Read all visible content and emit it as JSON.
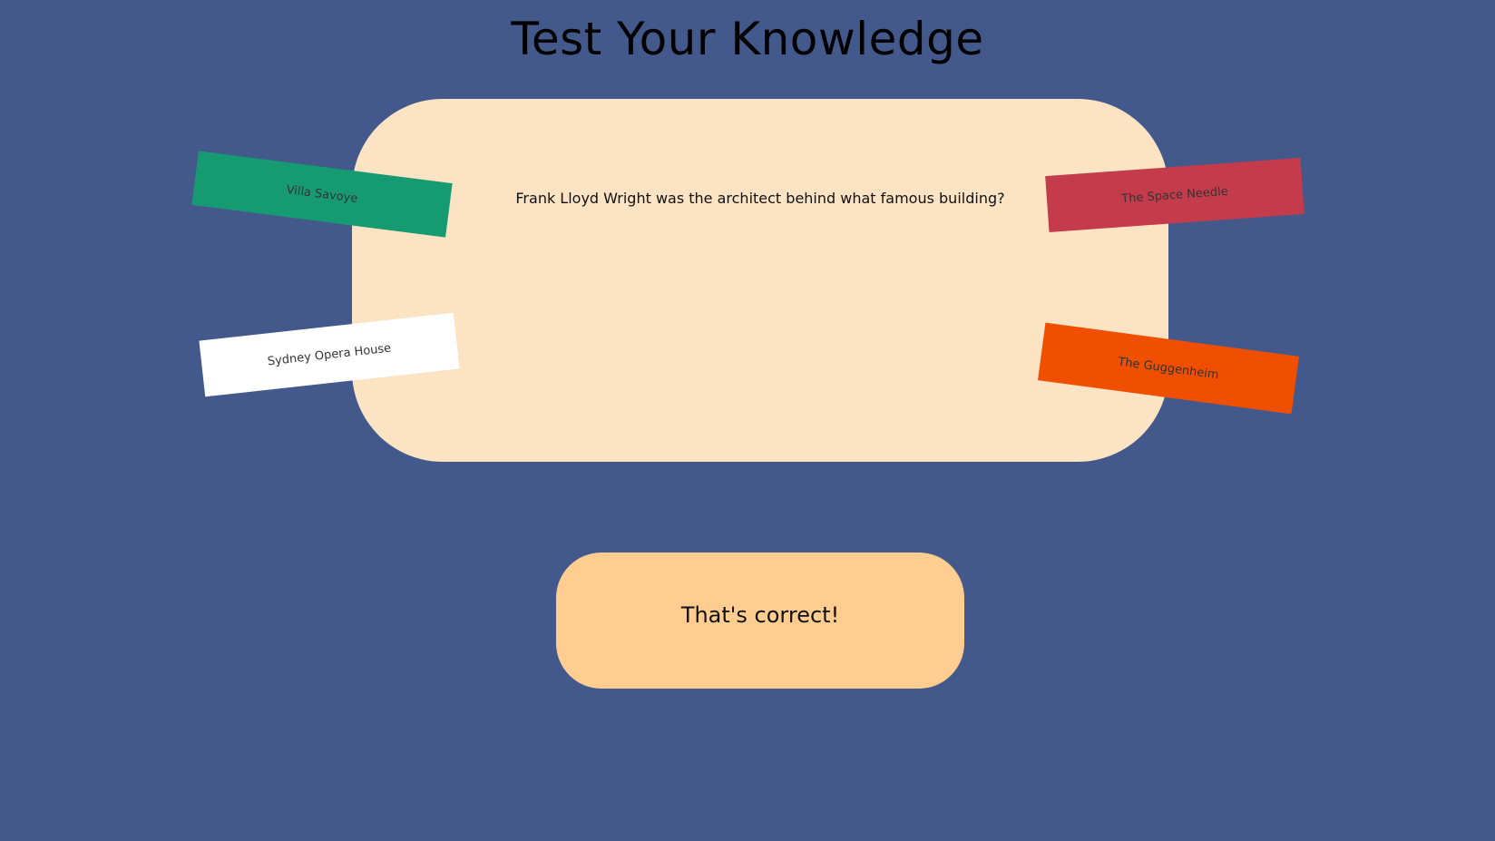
{
  "header": {
    "title": "Test Your Knowledge"
  },
  "quiz": {
    "question": "Frank Lloyd Wright was the architect behind what famous building?",
    "answers": [
      {
        "label": "Villa Savoye",
        "color": "#169a72"
      },
      {
        "label": "Sydney Opera House",
        "color": "#ffffff"
      },
      {
        "label": "The Space Needle",
        "color": "#c43b4c"
      },
      {
        "label": "The Guggenheim",
        "color": "#f04f00"
      }
    ]
  },
  "feedback": {
    "message": "That's correct!"
  },
  "colors": {
    "background": "#43598b",
    "card": "#fce3c3",
    "feedback": "#ffcd8f"
  }
}
